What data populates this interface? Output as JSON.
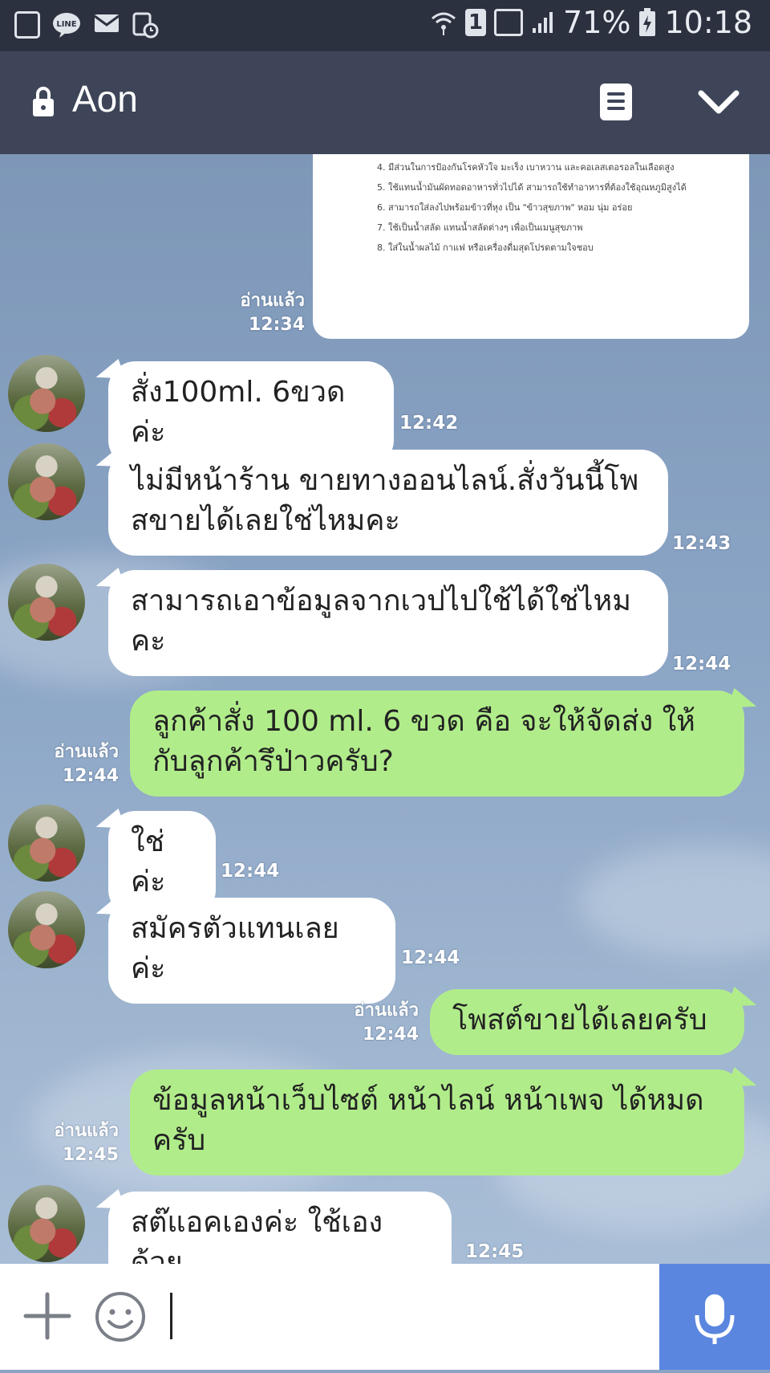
{
  "status_bar": {
    "icons_left": [
      "gallery-icon",
      "line-icon",
      "mail-icon",
      "alarm-icon"
    ],
    "sim_label": "1",
    "battery": "71%",
    "time": "10:18"
  },
  "header": {
    "title": "Aon",
    "icons": [
      "lock-icon",
      "notes-icon",
      "chevron-down-icon"
    ]
  },
  "image_message": {
    "lines": [
      "4.  มีส่วนในการป้องกันโรคหัวใจ มะเร็ง เบาหวาน และคอเลสเตอรอลในเลือดสูง",
      "5.  ใช้แทนน้ำมันผัดทอดอาหารทั่วไปได้  สามารถใช้ทำอาหารที่ต้องใช้อุณหภูมิสูงได้",
      "6.  สามารถใส่ลงไปพร้อมข้าวที่หุง เป็น \"ข้าวสุขภาพ\" หอม นุ่ม อร่อย",
      "7.  ใช้เป็นน้ำสลัด แทนน้ำสลัดต่างๆ เพื่อเป็นเมนูสุขภาพ",
      "8.  ใส่ในน้ำผลไม้ กาแฟ หรือเครื่องดื่มสุดโปรดตามใจชอบ"
    ],
    "read_label": "อ่านแล้ว",
    "time": "12:34"
  },
  "messages": [
    {
      "dir": "in",
      "lines": [
        "สั่ง100ml. 6ขวดค่ะ"
      ],
      "time": "12:42"
    },
    {
      "dir": "in",
      "lines": [
        "ไม่มีหน้าร้าน ขายทางออนไลน์.สั่งวันนี้โพ",
        "สขายได้เลยใช่ไหมคะ"
      ],
      "time": "12:43"
    },
    {
      "dir": "in",
      "lines": [
        "สามารถเอาข้อมูลจากเวปไปใช้ได้ใช่ไหม",
        "คะ"
      ],
      "time": "12:44"
    },
    {
      "dir": "out",
      "lines": [
        "ลูกค้าสั่ง 100   ml. 6 ขวด คือ จะให้จัดส่ง ให้",
        "กับลูกค้ารึป่าวครับ?"
      ],
      "read_label": "อ่านแล้ว",
      "time": "12:44"
    },
    {
      "dir": "in",
      "lines": [
        "ใช่ค่ะ"
      ],
      "time": "12:44"
    },
    {
      "dir": "in",
      "lines": [
        "สมัครตัวแทนเลยค่ะ"
      ],
      "time": "12:44"
    },
    {
      "dir": "out",
      "lines": [
        "โพสต์ขายได้เลยครับ"
      ],
      "read_label": "อ่านแล้ว",
      "time": "12:44"
    },
    {
      "dir": "out",
      "lines": [
        "ข้อมูลหน้าเว็บไซต์ หน้าไลน์ หน้าเพจ ได้หมด",
        "ครับ"
      ],
      "read_label": "อ่านแล้ว",
      "time": "12:45"
    },
    {
      "dir": "in",
      "lines": [
        "สต๊แอคเองค่ะ ใช้เองด้วย"
      ],
      "time": "12:45"
    }
  ],
  "input_bar": {
    "value": "",
    "icons": [
      "plus-icon",
      "emoji-icon",
      "microphone-icon"
    ]
  },
  "colors": {
    "header_bg": "#3e4558",
    "status_bg": "#2c3140",
    "incoming_bubble": "#ffffff",
    "outgoing_bubble": "#b1ec8b",
    "mic_button": "#5a86e0"
  }
}
